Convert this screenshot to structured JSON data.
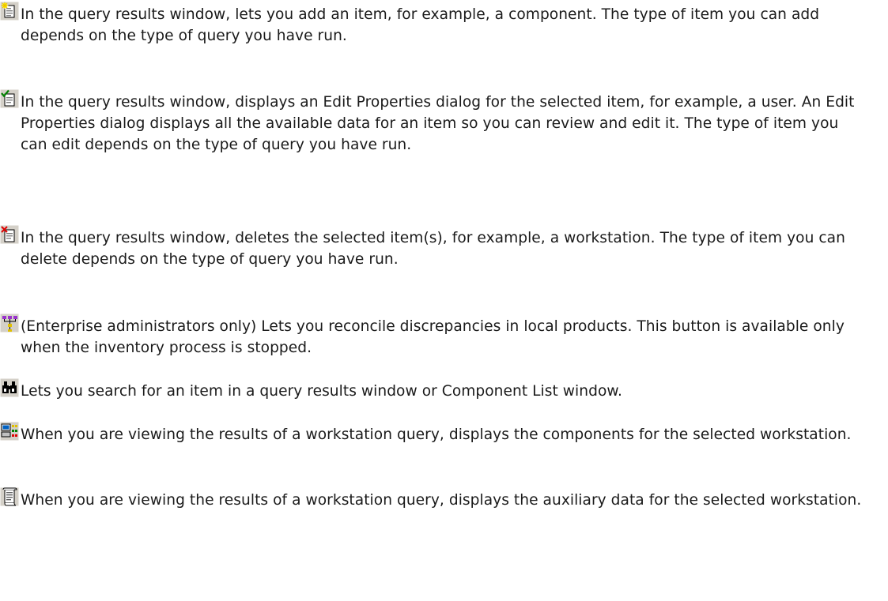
{
  "entries": [
    {
      "icon": "new-item-icon",
      "text": "In the query results window, lets you add an item, for example, a component. The type of item you can add depends on the type of query you have run."
    },
    {
      "icon": "edit-properties-icon",
      "text": "In the query results window, displays an Edit Properties dialog for the selected item, for example, a user. An Edit Properties dialog displays all the available data for an item so you can review and edit it. The type of item you can edit depends on the type of query you have run."
    },
    {
      "icon": "delete-item-icon",
      "text": "In the query results window, deletes the selected item(s), for example, a workstation. The type of item you can delete depends on the type of query you have run."
    },
    {
      "icon": "reconcile-products-icon",
      "text": "(Enterprise administrators only) Lets you reconcile discrepancies in local products. This button is available only when the inventory process is stopped."
    },
    {
      "icon": "binoculars-search-icon",
      "text": "Lets you search for an item in a query results window or Component List window."
    },
    {
      "icon": "workstation-components-icon",
      "text": "When you are viewing the results of a workstation query, displays the components for the selected workstation."
    },
    {
      "icon": "auxiliary-data-icon",
      "text": "When you are viewing the results of a workstation query, displays the auxiliary data for the selected workstation."
    }
  ]
}
